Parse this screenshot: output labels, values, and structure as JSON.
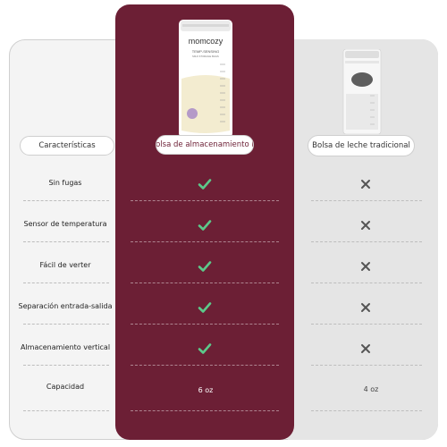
{
  "header": {
    "features_label": "Características",
    "product_label": "Bolsa de almacenamiento BI",
    "competitor_label": "Bolsa de leche tradicional"
  },
  "product_bag": {
    "brand": "momcozy",
    "subtitle": "TEMP-SENSING",
    "subtitle2": "MILK STORAGE BAGS"
  },
  "rows": [
    {
      "label": "Sin fugas",
      "product": "check",
      "competitor": "x"
    },
    {
      "label": "Sensor de temperatura",
      "product": "check",
      "competitor": "x"
    },
    {
      "label": "Fácil de verter",
      "product": "check",
      "competitor": "x"
    },
    {
      "label": "Separación entrada-salida",
      "product": "check",
      "competitor": "x"
    },
    {
      "label": "Almacenamiento vertical",
      "product": "check",
      "competitor": "x"
    }
  ],
  "capacity": {
    "label": "Capacidad",
    "product_value": "6 oz",
    "competitor_value": "4 oz"
  },
  "colors": {
    "accent": "#6c1f35",
    "check": "#5cc98a",
    "x": "#555555"
  }
}
